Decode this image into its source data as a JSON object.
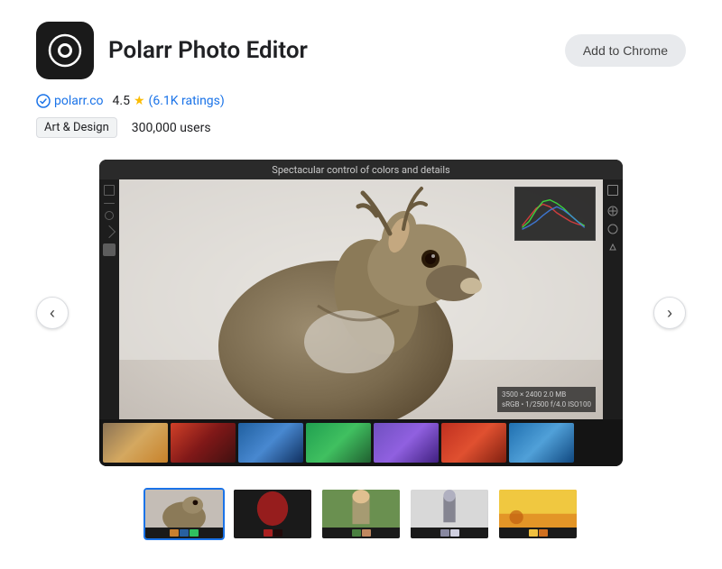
{
  "app": {
    "icon_label": "Polarr app icon",
    "title": "Polarr Photo Editor",
    "add_button_label": "Add to Chrome"
  },
  "meta": {
    "website": "polarr.co",
    "rating_value": "4.5",
    "rating_star": "★",
    "rating_count": "(6.1K ratings)",
    "tag": "Art & Design",
    "users": "300,000 users"
  },
  "screenshot": {
    "caption": "Spectacular control of colors and details",
    "info_line1": "3500 × 2400 2.0 MB",
    "info_line2": "sRGB • 1/2500 f/4.0 ISO100"
  },
  "nav": {
    "prev_arrow": "‹",
    "next_arrow": "›"
  },
  "thumbnails": [
    {
      "id": 1,
      "active": true
    },
    {
      "id": 2,
      "active": false
    },
    {
      "id": 3,
      "active": false
    },
    {
      "id": 4,
      "active": false
    },
    {
      "id": 5,
      "active": false
    }
  ]
}
